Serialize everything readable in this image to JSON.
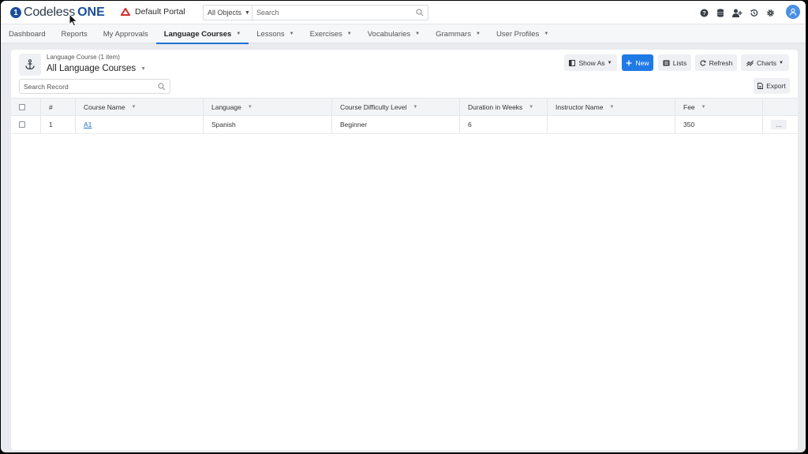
{
  "app": {
    "logo_text": "Codeless",
    "logo_one": "ONE",
    "portal_name": "Default Portal"
  },
  "global_search": {
    "scope": "All Objects",
    "placeholder": "Search"
  },
  "nav": {
    "items": [
      {
        "label": "Dashboard",
        "dropdown": false
      },
      {
        "label": "Reports",
        "dropdown": false
      },
      {
        "label": "My Approvals",
        "dropdown": false
      },
      {
        "label": "Language Courses",
        "dropdown": true,
        "active": true
      },
      {
        "label": "Lessons",
        "dropdown": true
      },
      {
        "label": "Exercises",
        "dropdown": true
      },
      {
        "label": "Vocabularies",
        "dropdown": true
      },
      {
        "label": "Grammars",
        "dropdown": true
      },
      {
        "label": "User Profiles",
        "dropdown": true
      }
    ]
  },
  "list": {
    "subtitle": "Language Course (1 item)",
    "title": "All Language Courses",
    "search_placeholder": "Search Record"
  },
  "toolbar": {
    "show_as": "Show As",
    "new": "New",
    "lists": "Lists",
    "refresh": "Refresh",
    "charts": "Charts",
    "export": "Export"
  },
  "table": {
    "headers": [
      "#",
      "Course Name",
      "Language",
      "Course Difficulty Level",
      "Duration in Weeks",
      "Instructor Name",
      "Fee"
    ],
    "rows": [
      {
        "num": "1",
        "course_name": "A1",
        "language": "Spanish",
        "difficulty": "Beginner",
        "duration": "6",
        "instructor": "",
        "fee": "350",
        "more": "..."
      }
    ]
  },
  "colors": {
    "accent": "#1f7ae6",
    "brand": "#1b4f9c",
    "portal_icon": "#d0312d"
  }
}
